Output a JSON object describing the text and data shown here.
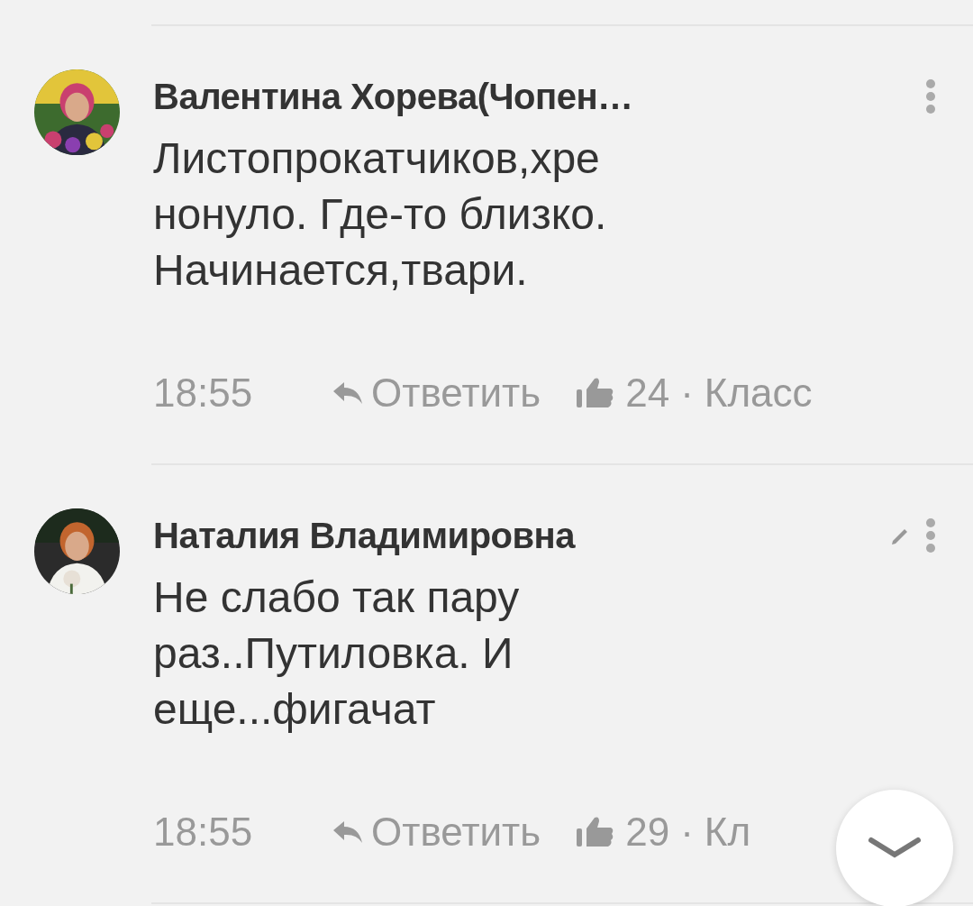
{
  "comments": [
    {
      "author": "Валентина Хорева(Чопен…",
      "editable": false,
      "text": "Листопрокатчиков,хре\nнонуло. Где-то близко.\nНачинается,твари.",
      "time": "18:55",
      "reply": "Ответить",
      "likes": "24",
      "separator": "·",
      "like_label": "Класс"
    },
    {
      "author": "Наталия Владимировна",
      "editable": true,
      "text": "Не слабо так пару\nраз..Путиловка. И\nеще...фигачат",
      "time": "18:55",
      "reply": "Ответить",
      "likes": "29",
      "separator": "·",
      "like_label": "Кл"
    }
  ],
  "scroll_down_button": {
    "visible": true
  }
}
